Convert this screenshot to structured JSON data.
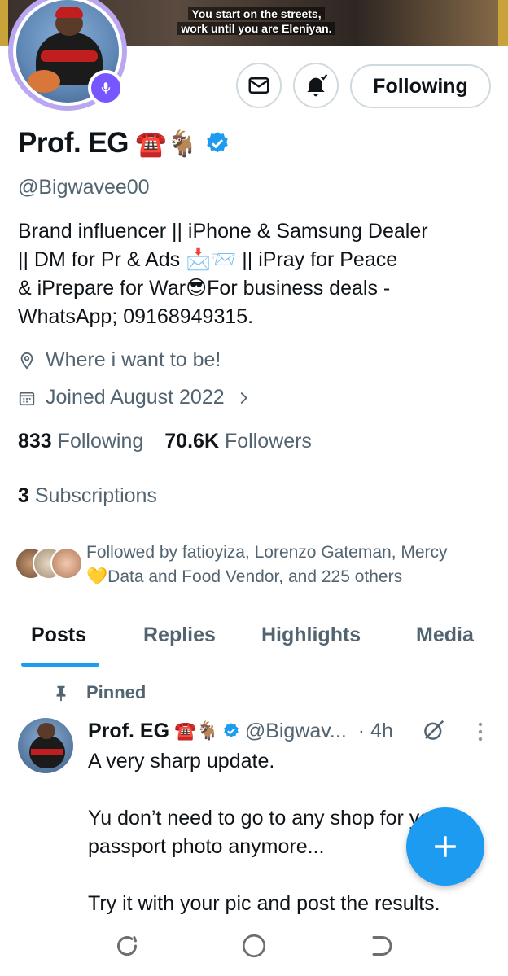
{
  "banner": {
    "caption_line1": "You start on the streets,",
    "caption_line2": "work until you are Eleniyan."
  },
  "header": {
    "follow_label": "Following"
  },
  "profile": {
    "name": "Prof. EG",
    "name_emoji": "☎️🐐",
    "handle": "@Bigwavee00",
    "bio_lines": [
      "Brand influencer || iPhone & Samsung Dealer",
      "|| DM for Pr & Ads 📩📨 || iPray for Peace",
      "& iPrepare for War😎For business deals -",
      "WhatsApp; 09168949315."
    ],
    "location": "Where i want to be!",
    "joined": "Joined August 2022",
    "following_count": "833",
    "following_label": "Following",
    "followers_count": "70.6K",
    "followers_label": "Followers",
    "subscriptions_count": "3",
    "subscriptions_label": "Subscriptions",
    "followed_by_line1": "Followed by fatioyiza, Lorenzo Gateman, Mercy",
    "followed_by_line2": "💛Data and Food Vendor, and 225 others"
  },
  "tabs": [
    {
      "label": "Posts",
      "active": true
    },
    {
      "label": "Replies",
      "active": false
    },
    {
      "label": "Highlights",
      "active": false
    },
    {
      "label": "Media",
      "active": false
    }
  ],
  "pinned_post": {
    "pinned_label": "Pinned",
    "author": "Prof. EG",
    "author_emoji": "☎️🐐",
    "handle": "@Bigwav...",
    "time": "· 4h",
    "text_lines": [
      "A very sharp update.",
      "",
      "Yu don’t need to go to any shop for your",
      "passport photo anymore...",
      "",
      "Try it with your pic and post the results."
    ]
  },
  "colors": {
    "accent": "#1d9bf0",
    "voice_badge": "#7856ff",
    "avatar_ring": "#b9a7f2",
    "text_secondary": "#536471"
  },
  "icons": [
    "mail-icon",
    "bell-icon",
    "location-icon",
    "calendar-icon",
    "pin-icon",
    "grok-icon",
    "more-icon",
    "plus-icon",
    "recents-icon",
    "home-icon",
    "back-icon"
  ]
}
